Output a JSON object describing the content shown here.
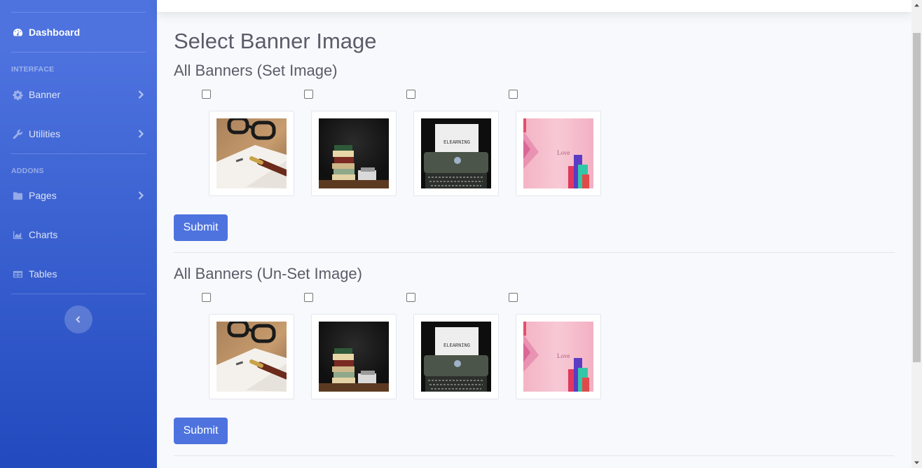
{
  "sidebar": {
    "items": [
      {
        "label": "Dashboard",
        "icon": "dashboard-icon",
        "active": true
      },
      {
        "label": "Banner",
        "icon": "gear-icon"
      },
      {
        "label": "Utilities",
        "icon": "wrench-icon"
      },
      {
        "label": "Pages",
        "icon": "folder-icon"
      },
      {
        "label": "Charts",
        "icon": "area-chart-icon"
      },
      {
        "label": "Tables",
        "icon": "table-icon"
      }
    ],
    "headings": {
      "interface": "INTERFACE",
      "addons": "ADDONS"
    }
  },
  "main": {
    "page_title": "Select Banner Image",
    "set_section": {
      "title": "All Banners (Set Image)",
      "submit_label": "Submit",
      "images": [
        "glasses-notebook-image",
        "book-stack-image",
        "typewriter-elearning-image",
        "pink-shopping-banner-image"
      ]
    },
    "unset_section": {
      "title": "All Banners (Un-Set Image)",
      "submit_label": "Submit",
      "images": [
        "glasses-notebook-image",
        "book-stack-image",
        "typewriter-elearning-image",
        "pink-shopping-banner-image"
      ]
    },
    "image_text": {
      "typewriter": "ELEARNING"
    }
  },
  "colors": {
    "primary": "#4e73df",
    "sidebar_end": "#224abe",
    "background": "#f8f9fc",
    "heading": "#5a5c69"
  }
}
